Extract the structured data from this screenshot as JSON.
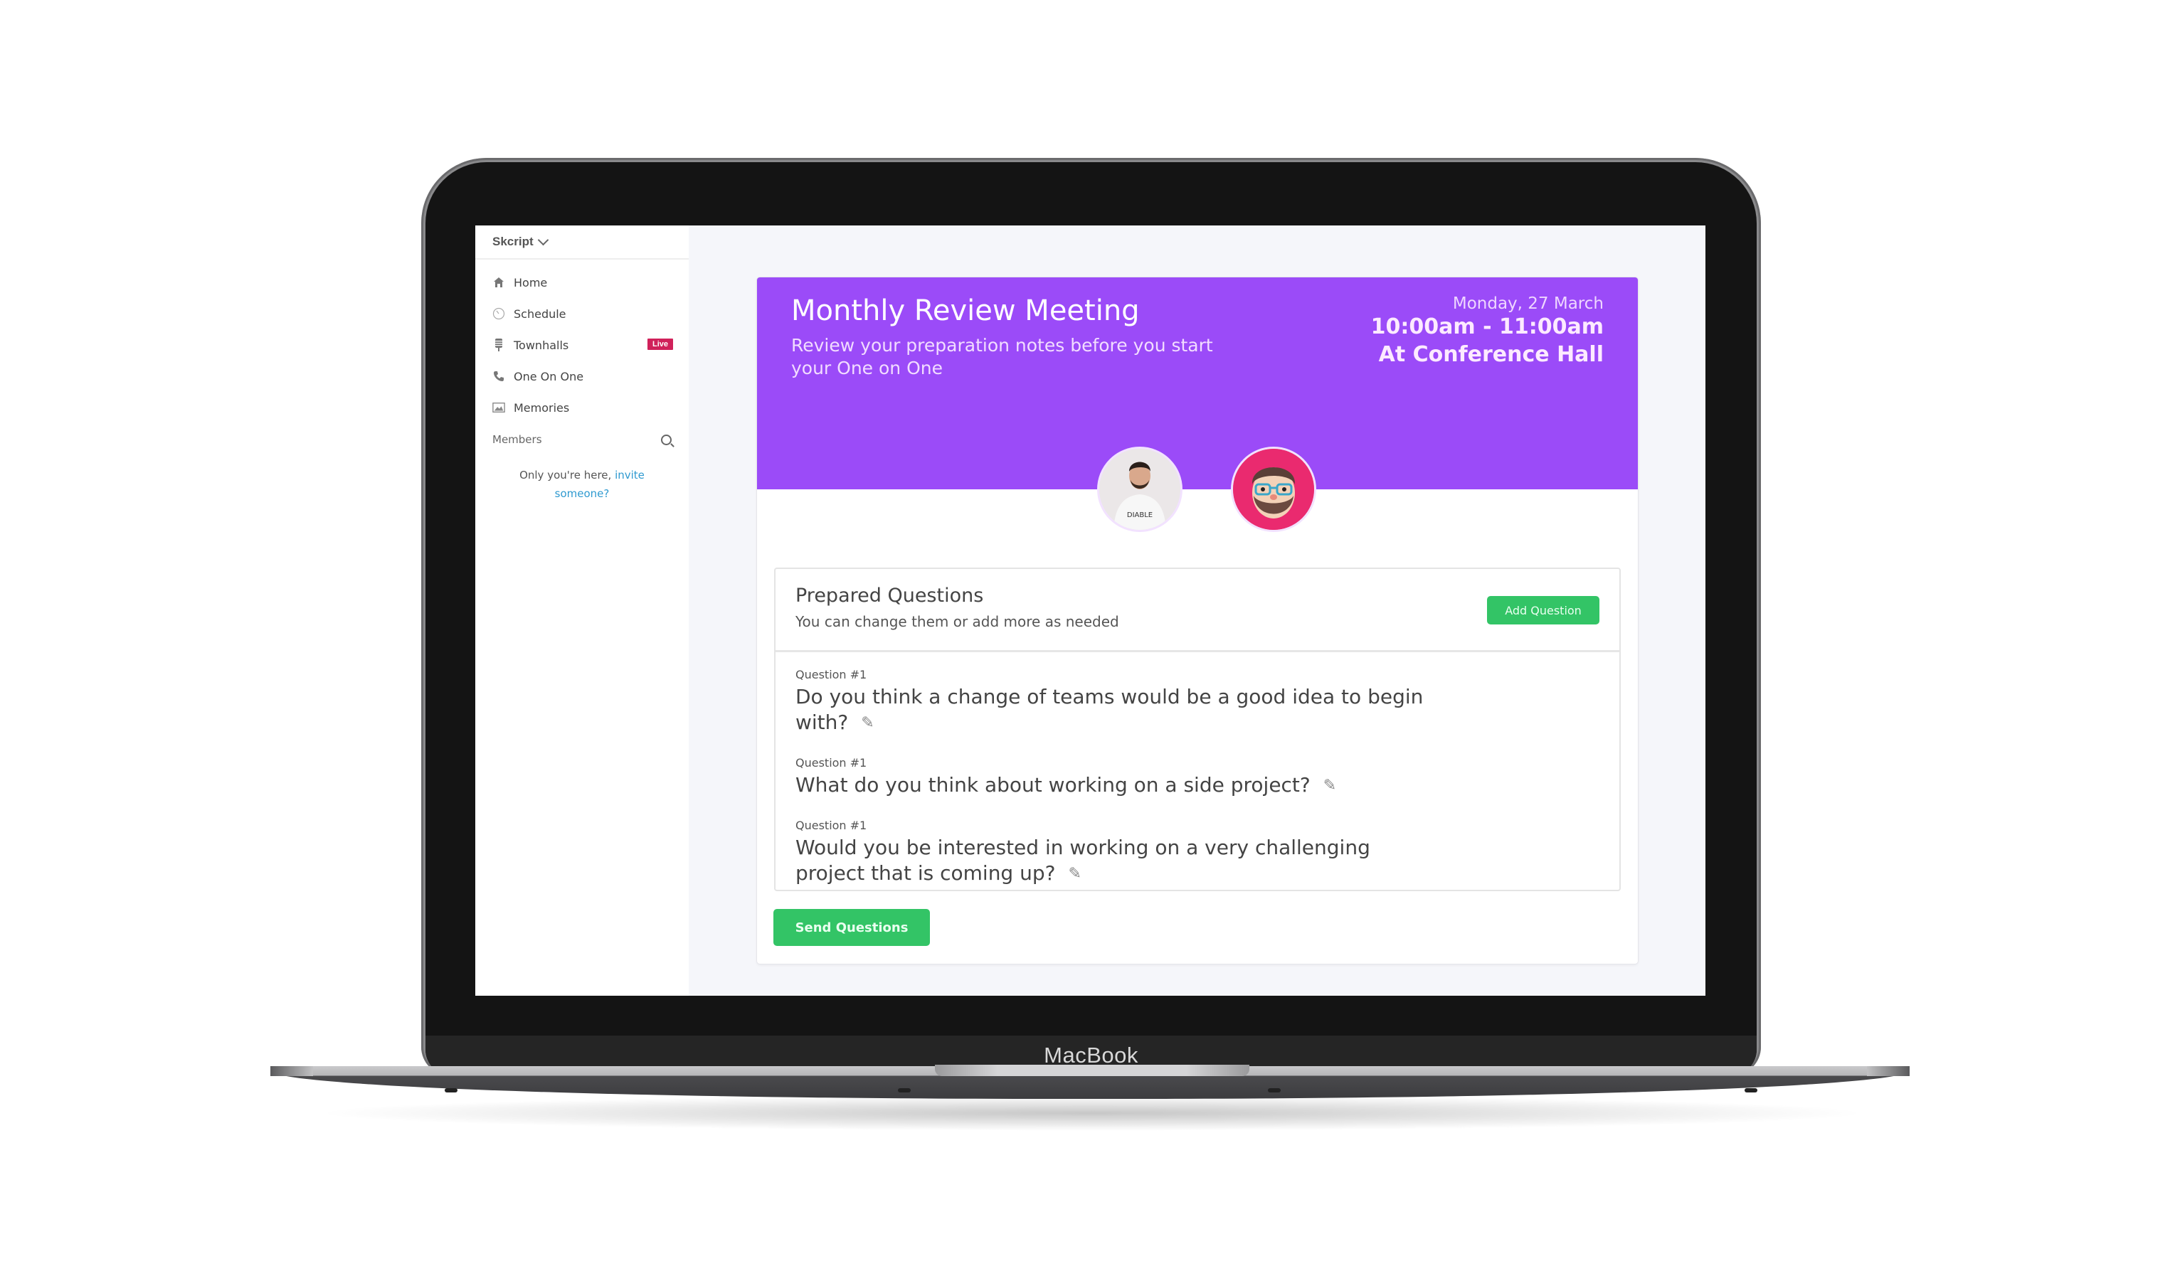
{
  "device": {
    "brand_label": "MacBook"
  },
  "sidebar": {
    "workspace": "Skcript",
    "items": [
      {
        "label": "Home",
        "icon": "home-icon"
      },
      {
        "label": "Schedule",
        "icon": "clock-icon"
      },
      {
        "label": "Townhalls",
        "icon": "microphone-icon",
        "badge": "Live"
      },
      {
        "label": "One On One",
        "icon": "phone-icon"
      },
      {
        "label": "Memories",
        "icon": "photos-icon"
      }
    ],
    "members_label": "Members",
    "invite_text": "Only you're here,",
    "invite_link": "invite someone?"
  },
  "meeting": {
    "title": "Monthly Review Meeting",
    "subtitle": "Review your preparation notes before you start your One on One",
    "date": "Monday, 27 March",
    "time": "10:00am - 11:00am",
    "location": "At Conference Hall",
    "colors": {
      "accent": "#9b4bf8",
      "button": "#33c466",
      "badge": "#d0215a",
      "link": "#2f9ad0"
    }
  },
  "questions_panel": {
    "title": "Prepared Questions",
    "description": "You can change them or add more as needed",
    "add_button": "Add Question",
    "questions": [
      {
        "label": "Question #1",
        "text": "Do you think a change of teams would be a good idea to begin with?"
      },
      {
        "label": "Question #1",
        "text": "What do you think about working on a side project?"
      },
      {
        "label": "Question #1",
        "text": "Would you be interested in working on a very challenging project that is coming up?"
      }
    ]
  },
  "send_button": "Send Questions"
}
